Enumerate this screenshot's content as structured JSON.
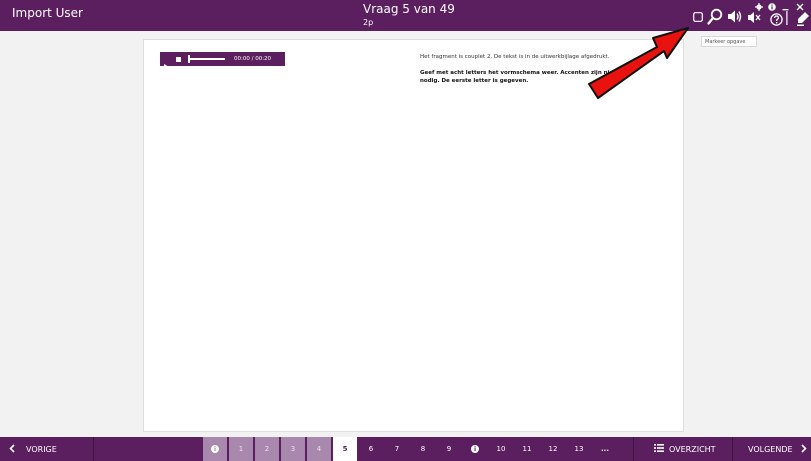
{
  "header": {
    "user_label": "Import User",
    "question_title": "Vraag 5 van 49",
    "question_points": "2p"
  },
  "toolbar": {
    "icons": [
      "checkbox-icon",
      "search-icon",
      "speaker-icon",
      "mute-icon",
      "gear-icon",
      "info-icon",
      "minimize-icon",
      "help-icon",
      "close-icon",
      "highlighter-icon"
    ],
    "tooltip": "Markeer opgave"
  },
  "audio": {
    "time": "00:00 / 00:20",
    "progress": 0.0
  },
  "content": {
    "instruction": "Het fragment is couplet 2. De tekst is in de uitwerkbijlage afgedrukt.",
    "question_part1": "Geef met acht letters het vormschema weer. Accenten zijn niet",
    "question_part2": "nodig. De eerste letter is gegeven."
  },
  "footer": {
    "prev_label": "VORIGE",
    "next_label": "VOLGENDE",
    "overview_label": "OVERZICHT",
    "pages": [
      {
        "label": "i",
        "state": "answered",
        "info": true
      },
      {
        "label": "1",
        "state": "answered"
      },
      {
        "label": "2",
        "state": "answered"
      },
      {
        "label": "3",
        "state": "answered"
      },
      {
        "label": "4",
        "state": "answered"
      },
      {
        "label": "5",
        "state": "current"
      },
      {
        "label": "6",
        "state": "open"
      },
      {
        "label": "7",
        "state": "open"
      },
      {
        "label": "8",
        "state": "open"
      },
      {
        "label": "9",
        "state": "open"
      },
      {
        "label": "i",
        "state": "open",
        "info": true
      },
      {
        "label": "10",
        "state": "open"
      },
      {
        "label": "11",
        "state": "open"
      },
      {
        "label": "12",
        "state": "open"
      },
      {
        "label": "13",
        "state": "open"
      },
      {
        "label": "...",
        "state": "open"
      }
    ]
  },
  "colors": {
    "brand": "#5b1f5f",
    "answered": "#a888ad",
    "arrow": "#e8130f"
  }
}
